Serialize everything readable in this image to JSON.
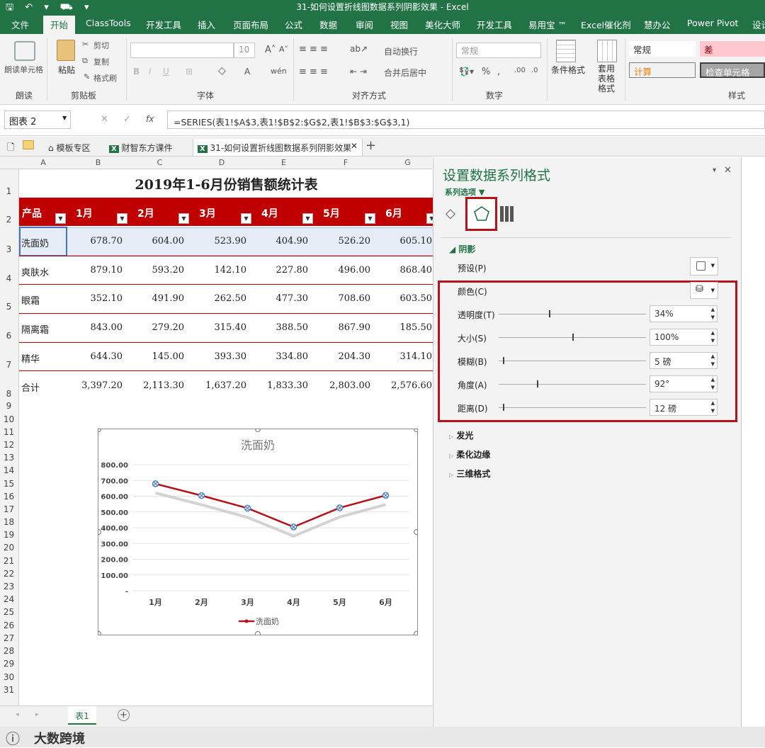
{
  "window": {
    "title": "31-如何设置折线图数据系列阴影效果 - Excel",
    "qat": "🖫 ↶ ▾ ⛟ ▾"
  },
  "menu": [
    "文件",
    "开始",
    "ClassTools",
    "开发工具",
    "插入",
    "页面布局",
    "公式",
    "数据",
    "审阅",
    "视图",
    "美化大师",
    "开发工具",
    "易用宝 ™",
    "Excel催化剂",
    "慧办公",
    "Power Pivot",
    "设计"
  ],
  "ribbon": {
    "read_cell": "朗读单元格",
    "group_read": "朗读",
    "paste": "粘贴",
    "cut": "剪切",
    "copy": "复制",
    "painter": "格式刷",
    "group_clipboard": "剪贴板",
    "font_size": "10",
    "group_font": "字体",
    "wrap": "自动换行",
    "merge": "合并后居中",
    "group_align": "对齐方式",
    "num_format": "常规",
    "group_number": "数字",
    "cond_format": "条件格式",
    "table_format": "套用表格格式",
    "style_normal": "常规",
    "style_bad": "差",
    "style_calc": "计算",
    "style_check": "检查单元格",
    "group_styles": "样式"
  },
  "formula": {
    "namebox": "图表 2",
    "fx": "fx",
    "text": "=SERIES(表1!$A$3,表1!$B$2:$G$2,表1!$B$3:$G$3,1)"
  },
  "doctabs": [
    "模板专区",
    "财智东方课件",
    "31-如何设置折线图数据系列阴影效果"
  ],
  "columns": [
    "A",
    "B",
    "C",
    "D",
    "E",
    "F",
    "G"
  ],
  "rows": [
    "1",
    "2",
    "3",
    "4",
    "5",
    "6",
    "7",
    "8",
    "9",
    "10",
    "11",
    "12",
    "13",
    "14",
    "15",
    "16",
    "17",
    "18",
    "19",
    "20",
    "21",
    "22",
    "23",
    "24",
    "25",
    "26",
    "27",
    "28",
    "29",
    "30",
    "31"
  ],
  "sheet": {
    "title": "2019年1-6月份销售额统计表",
    "headers": [
      "产品",
      "1月",
      "2月",
      "3月",
      "4月",
      "5月",
      "6月"
    ],
    "data": [
      [
        "洗面奶",
        "678.70",
        "604.00",
        "523.90",
        "404.90",
        "526.20",
        "605.10"
      ],
      [
        "爽肤水",
        "879.10",
        "593.20",
        "142.10",
        "227.80",
        "496.00",
        "868.40"
      ],
      [
        "眼霜",
        "352.10",
        "491.90",
        "262.50",
        "477.30",
        "708.60",
        "603.50"
      ],
      [
        "隔离霜",
        "843.00",
        "279.20",
        "315.40",
        "388.50",
        "867.90",
        "185.50"
      ],
      [
        "精华",
        "644.30",
        "145.00",
        "393.30",
        "334.80",
        "204.30",
        "314.10"
      ],
      [
        "合计",
        "3,397.20",
        "2,113.30",
        "1,637.20",
        "1,833.30",
        "2,803.00",
        "2,576.60"
      ]
    ]
  },
  "chart_data": {
    "type": "line",
    "title": "洗面奶",
    "categories": [
      "1月",
      "2月",
      "3月",
      "4月",
      "5月",
      "6月"
    ],
    "series": [
      {
        "name": "洗面奶",
        "values": [
          678.7,
          604.0,
          523.9,
          404.9,
          526.2,
          605.1
        ]
      }
    ],
    "ylim": [
      0,
      800
    ],
    "yticks": [
      "800.00",
      "700.00",
      "600.00",
      "500.00",
      "400.00",
      "300.00",
      "200.00",
      "100.00",
      "-"
    ],
    "legend": "bottom",
    "grid": true,
    "line_color": "#b5121b",
    "shadow": true
  },
  "panel": {
    "title": "设置数据系列格式",
    "subtitle": "系列选项 ▼",
    "section_shadow": "阴影",
    "preset": "预设(P)",
    "color": "颜色(C)",
    "params": [
      {
        "label": "透明度(T)",
        "value": "34%"
      },
      {
        "label": "大小(S)",
        "value": "100%"
      },
      {
        "label": "模糊(B)",
        "value": "5 磅"
      },
      {
        "label": "角度(A)",
        "value": "92°"
      },
      {
        "label": "距离(D)",
        "value": "12 磅"
      }
    ],
    "sections": [
      "发光",
      "柔化边缘",
      "三维格式"
    ]
  },
  "sheettab": "表1",
  "watermark": "大数跨境"
}
